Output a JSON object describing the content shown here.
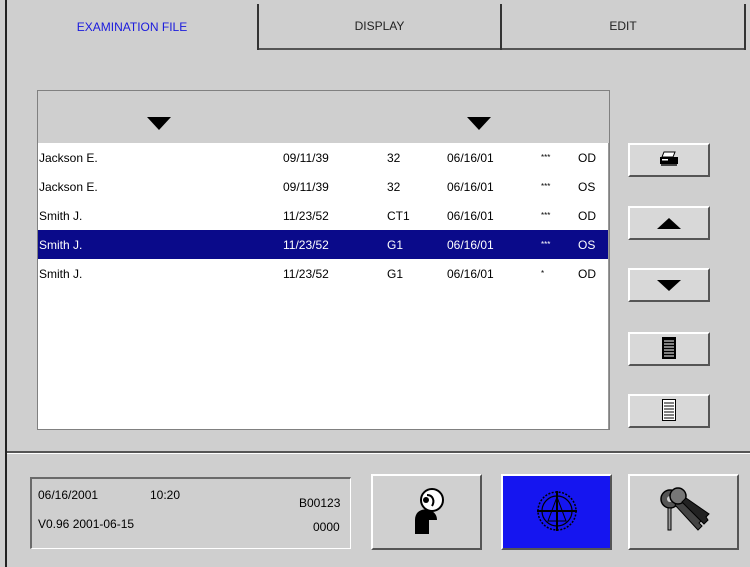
{
  "tabs": [
    {
      "label": "EXAMINATION FILE",
      "active": true
    },
    {
      "label": "DISPLAY",
      "active": false
    },
    {
      "label": "EDIT",
      "active": false
    }
  ],
  "records": [
    {
      "name": "Jackson E.",
      "birth_date": "09/11/39",
      "program": "32",
      "exam_date": "06/16/01",
      "reliability": "***",
      "eye": "OD",
      "selected": false
    },
    {
      "name": "Jackson E.",
      "birth_date": "09/11/39",
      "program": "32",
      "exam_date": "06/16/01",
      "reliability": "***",
      "eye": "OS",
      "selected": false
    },
    {
      "name": "Smith J.",
      "birth_date": "11/23/52",
      "program": "CT1",
      "exam_date": "06/16/01",
      "reliability": "***",
      "eye": "OD",
      "selected": false
    },
    {
      "name": "Smith J.",
      "birth_date": "11/23/52",
      "program": "G1",
      "exam_date": "06/16/01",
      "reliability": "***",
      "eye": "OS",
      "selected": true
    },
    {
      "name": "Smith J.",
      "birth_date": "11/23/52",
      "program": "G1",
      "exam_date": "06/16/01",
      "reliability": "*",
      "eye": "OD",
      "selected": false
    }
  ],
  "status": {
    "date": "06/16/2001",
    "time": "10:20",
    "version": "V0.96  2001-06-15",
    "device_id": "B00123",
    "counter": "0000"
  },
  "icons": {
    "print": "printer-icon",
    "scroll_up": "arrow-up-icon",
    "scroll_down": "arrow-down-icon",
    "page_full": "document-filled-icon",
    "page_empty": "document-lines-icon",
    "patient": "patient-icon",
    "perimetry": "visual-field-icon",
    "keys": "keys-icon"
  },
  "colors": {
    "selection": "#0a0a8a",
    "active_tab_text": "#1a1add",
    "perimetry_button": "#1515f0"
  }
}
